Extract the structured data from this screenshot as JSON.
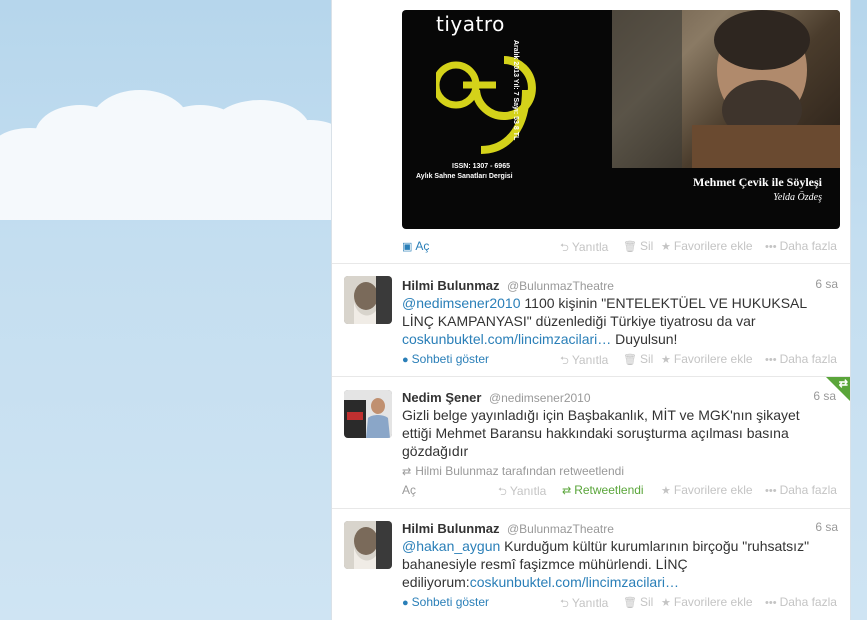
{
  "media_tweet": {
    "image": {
      "magazine_title": "tiyatro",
      "issue_info": "Aralık 2013 Yıl: 7 Sayı: 53 8 TL",
      "issn": "ISSN: 1307 - 6965",
      "subtitle": "Aylık Sahne Sanatları Dergisi",
      "caption": "Mehmet Çevik ile Söyleşi",
      "author": "Yelda Özdeş"
    },
    "expand_label": "Aç",
    "reply_label": "Yanıtla",
    "delete_label": "Sil",
    "favorite_label": "Favorilere ekle",
    "more_label": "Daha fazla"
  },
  "tweets": [
    {
      "fullname": "Hilmi Bulunmaz",
      "username": "@BulunmazTheatre",
      "time": "6 sa",
      "mention": "@nedimsener2010",
      "text": " 1100 kişinin \"ENTELEKTÜEL VE HUKUKSAL LİNÇ KAMPANYASI\" düzenlediği Türkiye tiyatrosu da var ",
      "link": "coskunbuktel.com/lincimzacilari…",
      "text_after": " Duyulsun!",
      "expand_label": "Sohbeti göster",
      "reply_label": "Yanıtla",
      "delete_label": "Sil",
      "favorite_label": "Favorilere ekle",
      "more_label": "Daha fazla"
    },
    {
      "fullname": "Nedim Şener",
      "username": "@nedimsener2010",
      "time": "6 sa",
      "text": "Gizli belge yayınladığı için Başbakanlık, MİT ve MGK'nın şikayet ettiği Mehmet Baransu hakkındaki soruşturma açılması basına gözdağıdır",
      "retweet_info": "Hilmi Bulunmaz tarafından retweetlendi",
      "expand_label": "Aç",
      "reply_label": "Yanıtla",
      "retweeted_label": "Retweetlendi",
      "favorite_label": "Favorilere ekle",
      "more_label": "Daha fazla"
    },
    {
      "fullname": "Hilmi Bulunmaz",
      "username": "@BulunmazTheatre",
      "time": "6 sa",
      "mention": "@hakan_aygun",
      "text": " Kurduğum kültür kurumlarının birçoğu \"ruhsatsız\" bahanesiyle resmî faşizmce mühürlendi. LİNÇ ediliyorum:",
      "link": "coskunbuktel.com/lincimzacilari…",
      "expand_label": "Sohbeti göster",
      "reply_label": "Yanıtla",
      "delete_label": "Sil",
      "favorite_label": "Favorilere ekle",
      "more_label": "Daha fazla"
    }
  ],
  "colors": {
    "link": "#2a7fb8",
    "retweet_green": "#5aa53a",
    "muted": "#999999"
  }
}
